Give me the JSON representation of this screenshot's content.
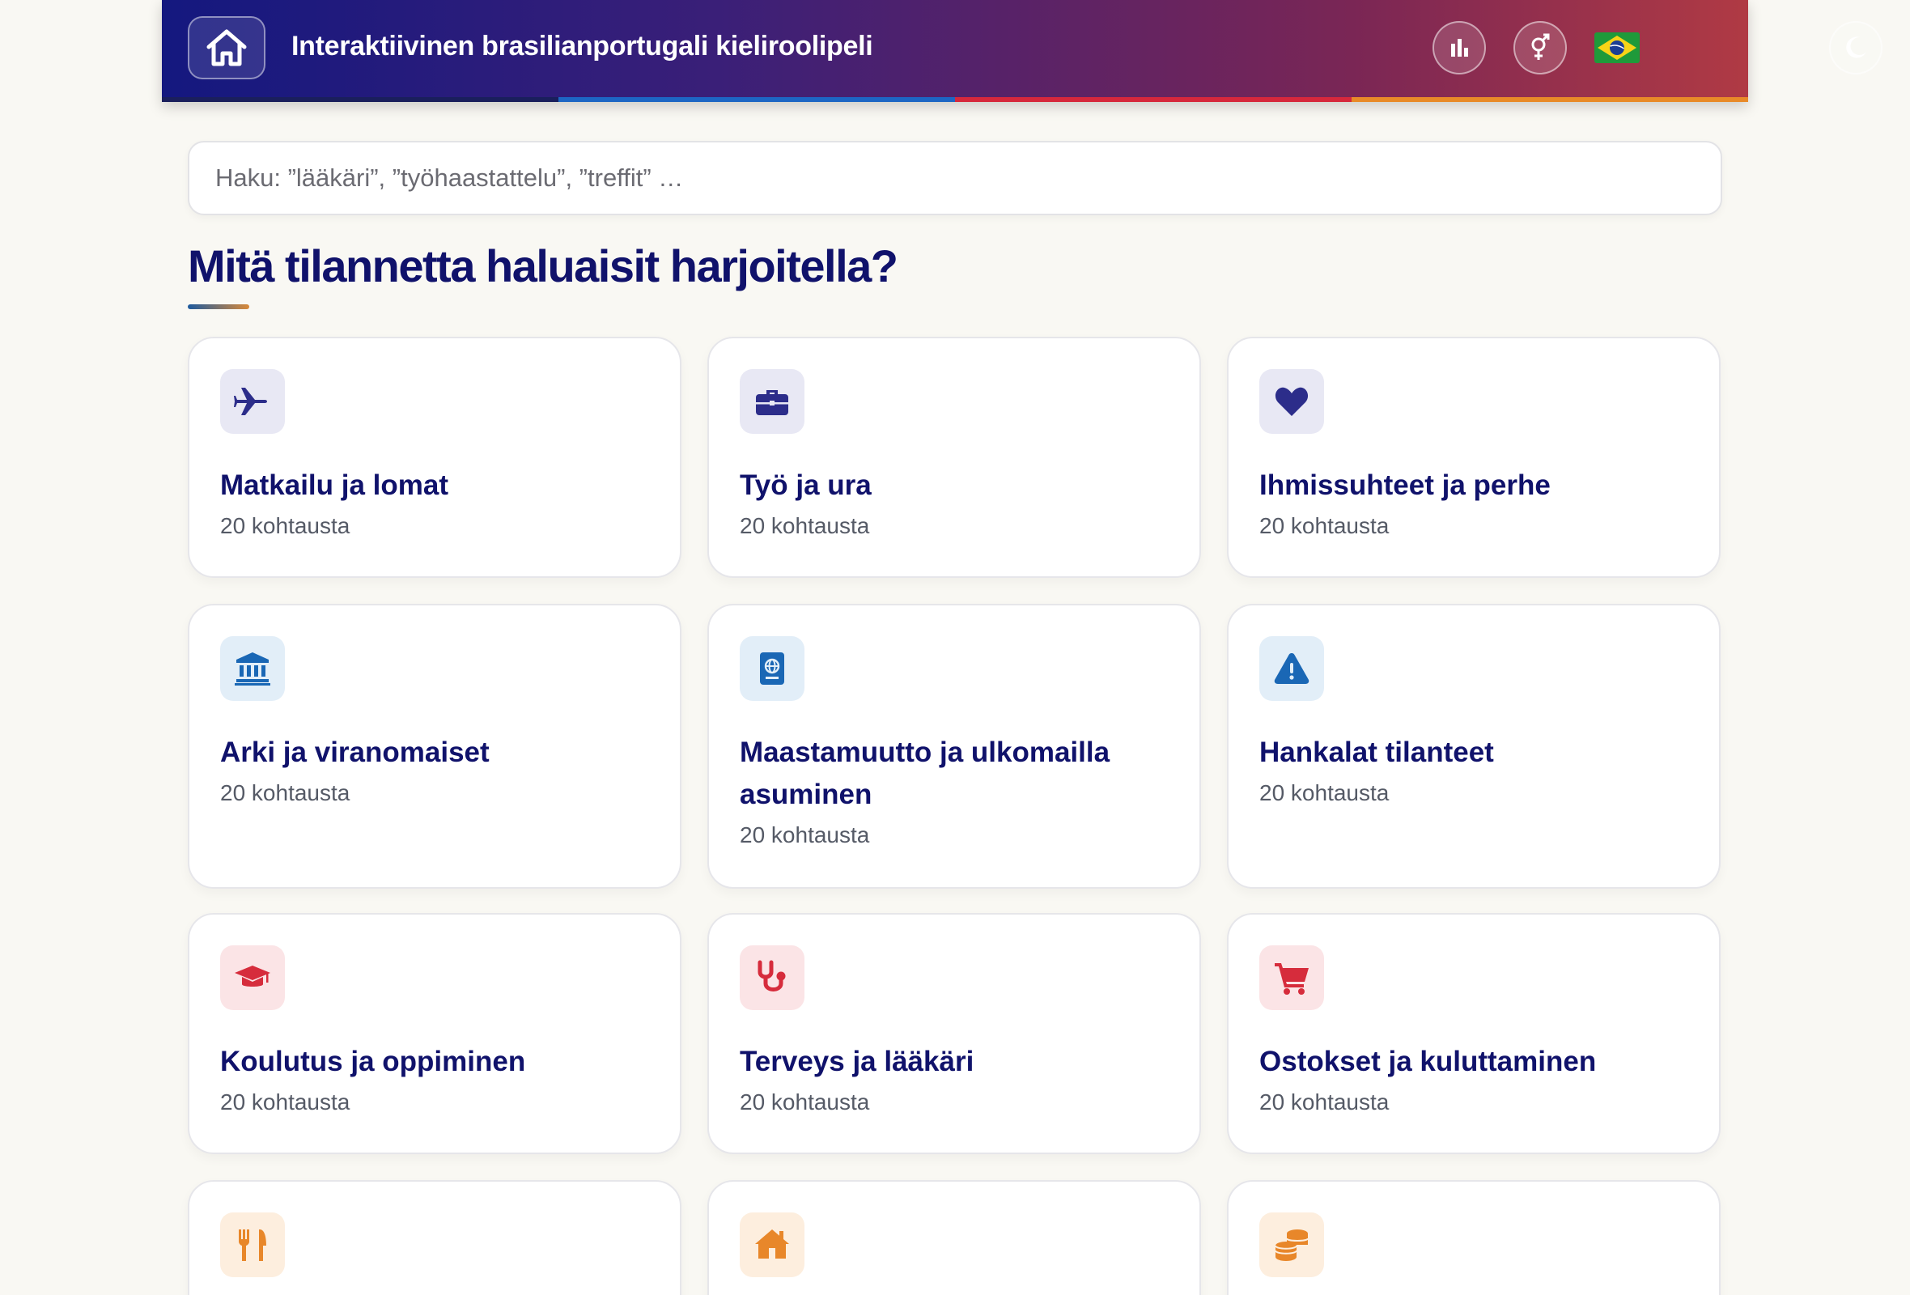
{
  "header": {
    "title": "Interaktiivinen brasilianportugali kieliroolipeli",
    "icons": {
      "home": "home-icon",
      "stats": "bar-chart-icon",
      "gender": "gender-symbol-icon",
      "language": "brazil-flag-icon",
      "theme": "moon-icon"
    },
    "stripe_colors": [
      "#1a1f5c",
      "#1d66c4",
      "#d6283c",
      "#e88a28"
    ]
  },
  "search": {
    "placeholder": "Haku: ”lääkäri”, ”työhaastattelu”, ”treffit” …",
    "value": ""
  },
  "main": {
    "heading": "Mitä tilannetta haluaisit harjoitella?"
  },
  "categories": [
    {
      "title": "Matkailu ja lomat",
      "count": "20 kohtausta",
      "icon": "airplane-icon",
      "accent": "#2c2d8a",
      "bg": "#e8e8f4"
    },
    {
      "title": "Työ ja ura",
      "count": "20 kohtausta",
      "icon": "briefcase-icon",
      "accent": "#2c2d8a",
      "bg": "#e8e8f4"
    },
    {
      "title": "Ihmissuhteet ja perhe",
      "count": "20 kohtausta",
      "icon": "heart-icon",
      "accent": "#2c2d8a",
      "bg": "#e8e8f4"
    },
    {
      "title": "Arki ja viranomaiset",
      "count": "20 kohtausta",
      "icon": "government-building-icon",
      "accent": "#1a67b5",
      "bg": "#e2eef8"
    },
    {
      "title": "Maastamuutto ja ulkomailla asuminen",
      "count": "20 kohtausta",
      "icon": "passport-icon",
      "accent": "#1a67b5",
      "bg": "#e2eef8"
    },
    {
      "title": "Hankalat tilanteet",
      "count": "20 kohtausta",
      "icon": "warning-icon",
      "accent": "#1a67b5",
      "bg": "#e2eef8"
    },
    {
      "title": "Koulutus ja oppiminen",
      "count": "20 kohtausta",
      "icon": "graduation-cap-icon",
      "accent": "#d62c3c",
      "bg": "#fbe4e6"
    },
    {
      "title": "Terveys ja lääkäri",
      "count": "20 kohtausta",
      "icon": "stethoscope-icon",
      "accent": "#d62c3c",
      "bg": "#fbe4e6"
    },
    {
      "title": "Ostokset ja kuluttaminen",
      "count": "20 kohtausta",
      "icon": "shopping-cart-icon",
      "accent": "#d62c3c",
      "bg": "#fbe4e6"
    },
    {
      "title": "",
      "count": "",
      "icon": "fork-knife-icon",
      "accent": "#e8872a",
      "bg": "#fdeede"
    },
    {
      "title": "",
      "count": "",
      "icon": "house-icon",
      "accent": "#e8872a",
      "bg": "#fdeede"
    },
    {
      "title": "",
      "count": "",
      "icon": "coins-icon",
      "accent": "#e8872a",
      "bg": "#fdeede"
    }
  ]
}
